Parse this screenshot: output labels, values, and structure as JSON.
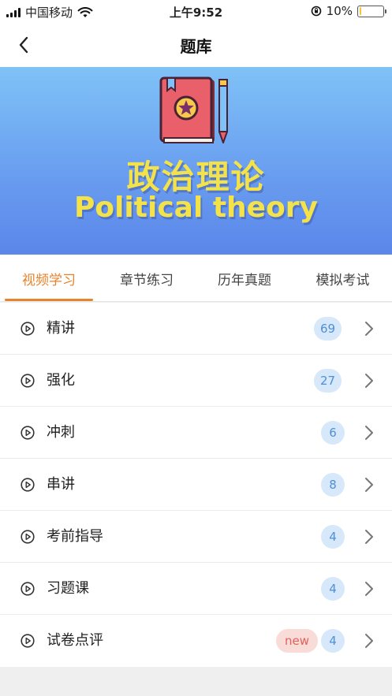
{
  "status_bar": {
    "carrier": "中国移动",
    "time": "上午9:52",
    "battery_percent": "10%",
    "battery_level": 0.1
  },
  "nav": {
    "title": "题库",
    "back_icon": "chevron-left-icon"
  },
  "banner": {
    "title_cn": "政治理论",
    "title_en": "Political theory",
    "illustration": "book-pencil-icon"
  },
  "tabs": [
    {
      "label": "视频学习",
      "active": true
    },
    {
      "label": "章节练习",
      "active": false
    },
    {
      "label": "历年真题",
      "active": false
    },
    {
      "label": "模拟考试",
      "active": false
    }
  ],
  "list": [
    {
      "label": "精讲",
      "count": "69"
    },
    {
      "label": "强化",
      "count": "27"
    },
    {
      "label": "冲刺",
      "count": "6"
    },
    {
      "label": "串讲",
      "count": "8"
    },
    {
      "label": "考前指导",
      "count": "4"
    },
    {
      "label": "习题课",
      "count": "4"
    },
    {
      "label": "试卷点评",
      "count": "4",
      "tag": "new"
    }
  ],
  "colors": {
    "accent": "#e8832b",
    "badge_bg": "#d6e8fa",
    "badge_text": "#4f8fd6",
    "new_bg": "#f9dbd8",
    "new_text": "#e0625a",
    "banner_top": "#7fc2f7",
    "banner_bottom": "#5b86ea",
    "banner_title": "#f4e24a"
  }
}
